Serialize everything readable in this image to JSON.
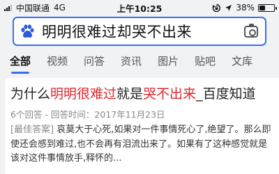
{
  "status_bar": {
    "carrier": "中国联通",
    "network": "4G",
    "time": "上午10:25",
    "battery_percent": "38%",
    "battery_level": 0.38
  },
  "search": {
    "query": "明明很难过却哭不出来",
    "icons": {
      "left": "baidu-paw-icon",
      "right": "camera-icon"
    }
  },
  "tabs": [
    {
      "label": "全部",
      "active": true
    },
    {
      "label": "视频",
      "active": false
    },
    {
      "label": "问答",
      "active": false
    },
    {
      "label": "资讯",
      "active": false
    },
    {
      "label": "图片",
      "active": false
    },
    {
      "label": "贴吧",
      "active": false
    },
    {
      "label": "文库",
      "active": false
    }
  ],
  "result": {
    "title_parts": [
      "为什么",
      "明明很难过",
      "就是",
      "哭不出来",
      "_百度知道"
    ],
    "meta": "6个回答 - 回答时间：2017年11月23日",
    "snippet_tag": "[最佳答案]",
    "snippet": " 哀莫大于心死,如果对一件事情死心了,绝望了。那么即使还会感到难过,也不会再有泪流出来了。如果有了这种感觉就是该对这件事情放手,释怀的..."
  },
  "colors": {
    "accent": "#3a6df0",
    "highlight": "#e0262c",
    "page_bg": "#f1f2f4"
  }
}
